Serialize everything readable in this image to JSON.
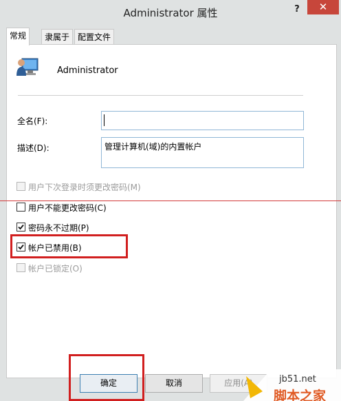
{
  "window": {
    "title": "Administrator 属性",
    "help_label": "?",
    "close_label": "✕"
  },
  "tabs": [
    {
      "label": "常规",
      "active": true
    },
    {
      "label": "隶属于",
      "active": false
    },
    {
      "label": "配置文件",
      "active": false
    }
  ],
  "user": {
    "name": "Administrator",
    "icon": "user-computer-icon"
  },
  "fields": {
    "full_name": {
      "label": "全名(F):",
      "value": ""
    },
    "description": {
      "label": "描述(D):",
      "value": "管理计算机(域)的内置帐户"
    }
  },
  "checkboxes": [
    {
      "label": "用户下次登录时须更改密码(M)",
      "checked": false,
      "enabled": false
    },
    {
      "label": "用户不能更改密码(C)",
      "checked": false,
      "enabled": true
    },
    {
      "label": "密码永不过期(P)",
      "checked": true,
      "enabled": true
    },
    {
      "label": "帐户已禁用(B)",
      "checked": true,
      "enabled": true
    },
    {
      "label": "帐户已锁定(O)",
      "checked": false,
      "enabled": false
    }
  ],
  "buttons": {
    "ok": "确定",
    "cancel": "取消",
    "apply": "应用(A)"
  },
  "watermark": {
    "url": "jb51.net",
    "name": "脚本之家"
  },
  "colors": {
    "close": "#c7463b",
    "annotation": "#d11f1f",
    "textbox_border": "#8fb6d6"
  }
}
